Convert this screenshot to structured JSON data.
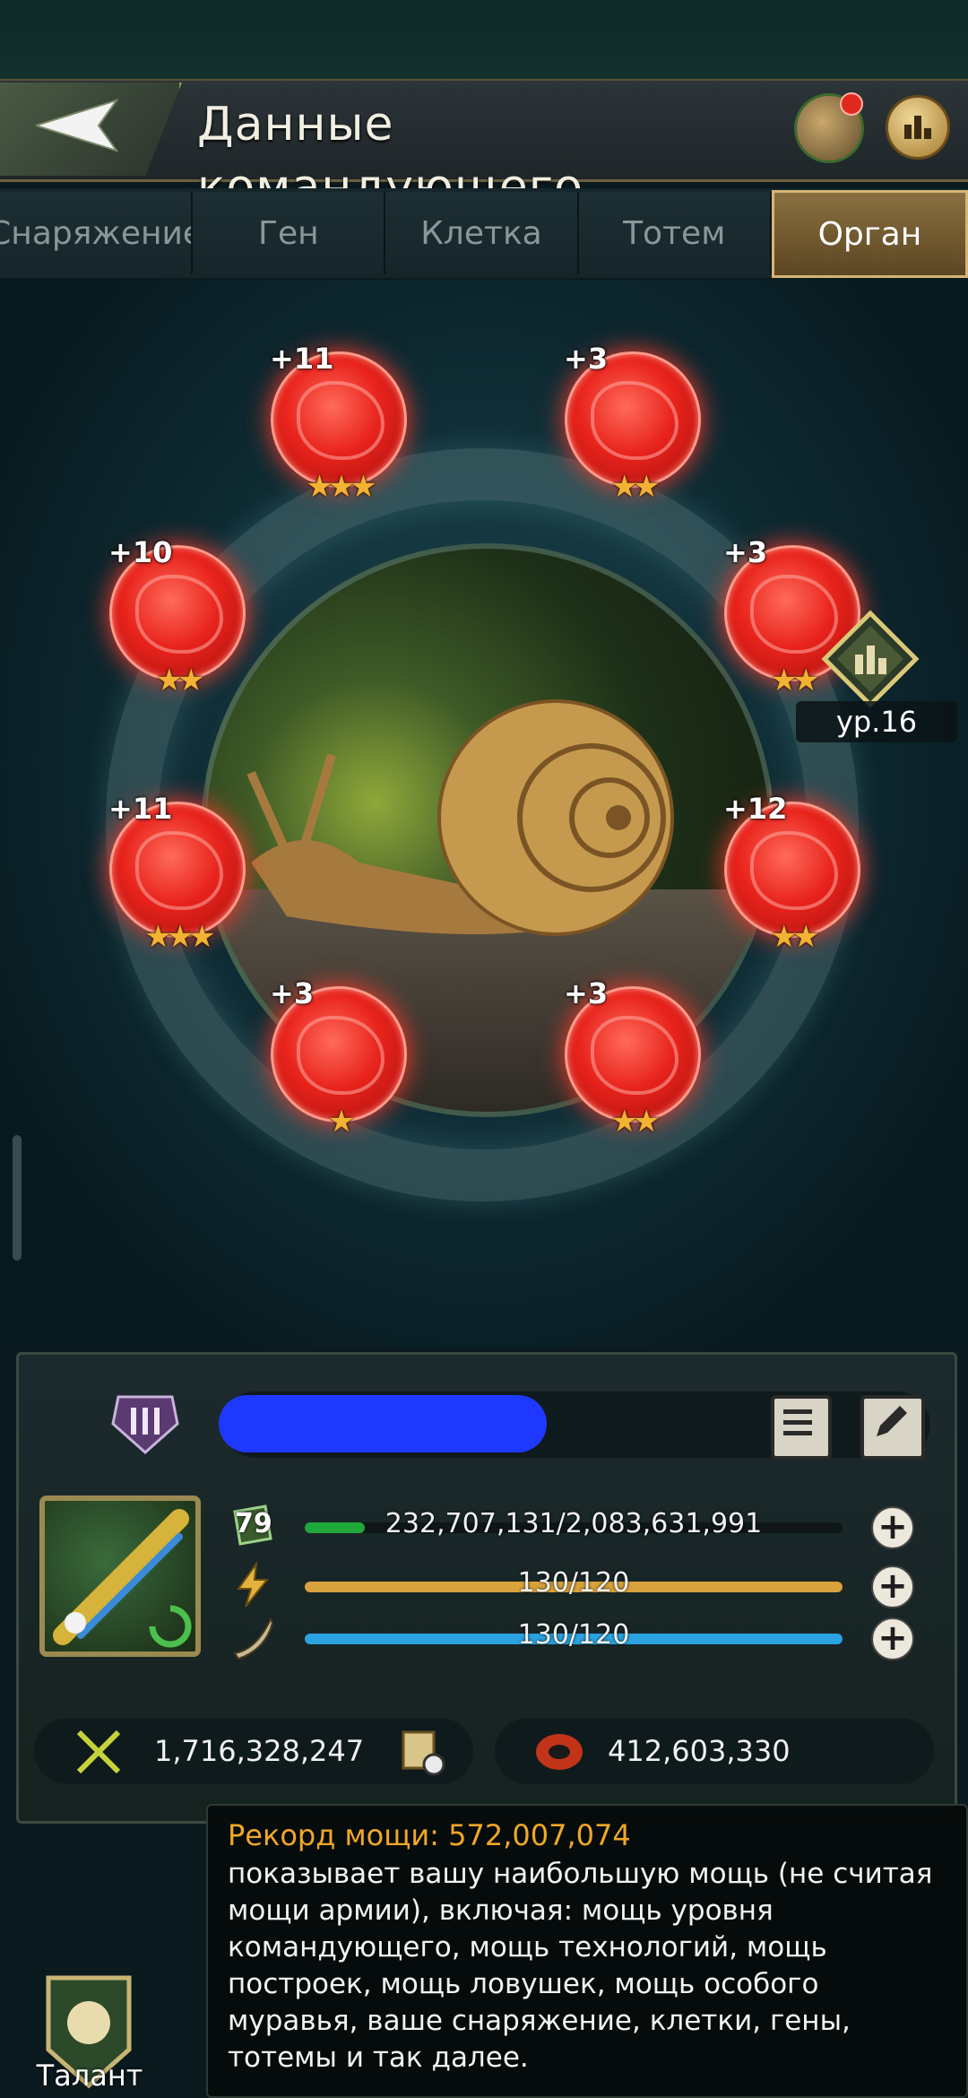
{
  "header": {
    "title": "Данные командующего",
    "back_icon": "back-arrow-icon",
    "profile_icon": "snail-badge-icon",
    "ranking_icon": "ranking-icon"
  },
  "tabs": [
    {
      "label": "Снаряжение",
      "active": false
    },
    {
      "label": "Ген",
      "active": false
    },
    {
      "label": "Клетка",
      "active": false
    },
    {
      "label": "Тотем",
      "active": false
    },
    {
      "label": "Орган",
      "active": true
    }
  ],
  "organs": [
    {
      "level": "+11",
      "stars": 3
    },
    {
      "level": "+3",
      "stars": 2
    },
    {
      "level": "+10",
      "stars": 2
    },
    {
      "level": "+3",
      "stars": 2
    },
    {
      "level": "+11",
      "stars": 3
    },
    {
      "level": "+12",
      "stars": 2
    },
    {
      "level": "+3",
      "stars": 1
    },
    {
      "level": "+3",
      "stars": 2
    }
  ],
  "level_badge": {
    "label": "ур.16",
    "icon": "bar-chart-icon"
  },
  "profile": {
    "rank_icon": "rank-III-icon",
    "level": "79",
    "exp": "232,707,131/2,083,631,991",
    "exp_fraction": 0.112,
    "energy": "130/120",
    "energy_fraction": 1.0,
    "stamina": "130/120",
    "stamina_fraction": 1.0,
    "power": "1,716,328,247",
    "army_power": "412,603,330"
  },
  "tooltip": {
    "title": "Рекорд мощи: 572,007,074",
    "body": "показывает вашу наибольшую мощь (не считая мощи армии), включая: мощь уровня командующего, мощь технологий, мощь построек, мощь ловушек, мощь особого муравья, ваше снаряжение, клетки, гены, тотемы и так далее."
  },
  "talent": {
    "label": "Талант"
  },
  "colors": {
    "accent_gold": "#d6b574",
    "organ_red": "#e8231c",
    "exp_green": "#20a83a",
    "energy_orange": "#d8a23c",
    "stamina_blue": "#2aa3e0",
    "tooltip_orange": "#f0a826"
  }
}
